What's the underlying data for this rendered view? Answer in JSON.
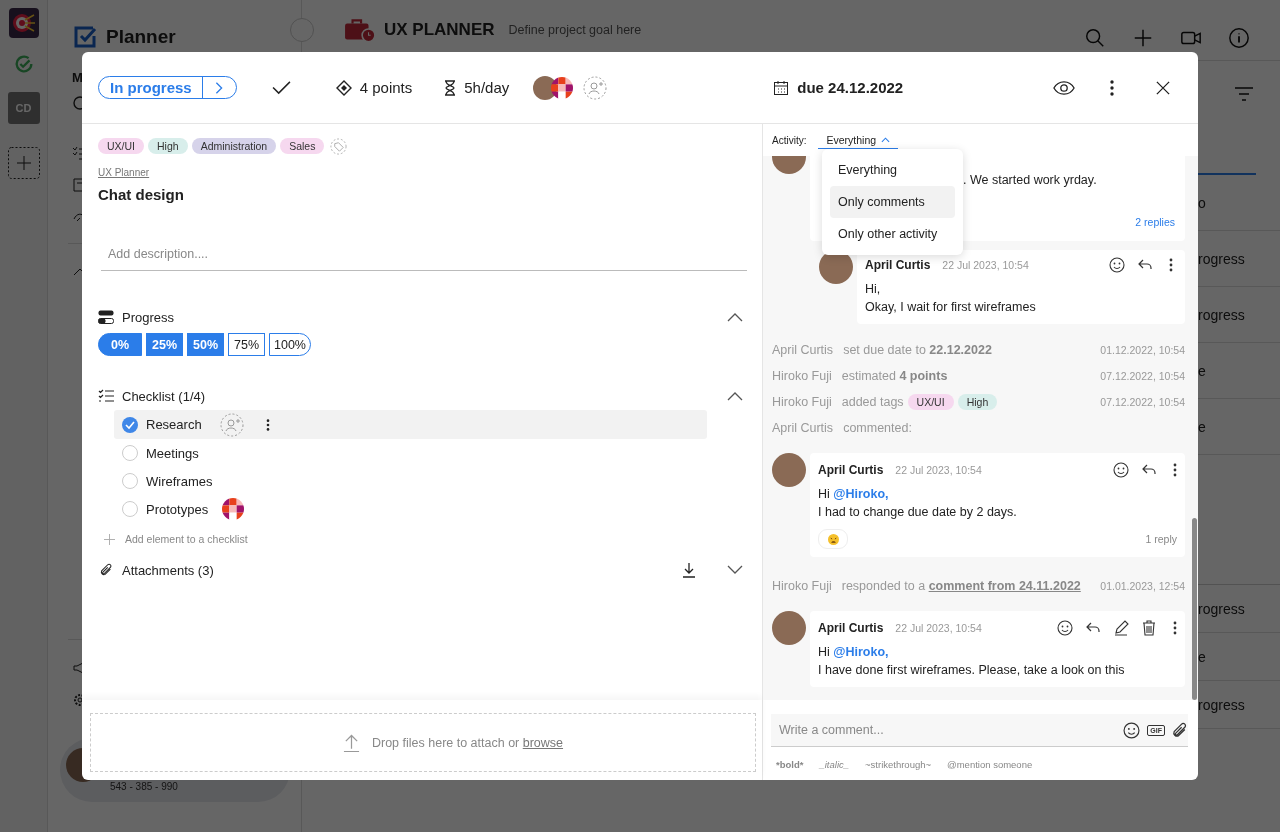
{
  "background": {
    "rail": {
      "badge": "CD"
    },
    "sidebar": {
      "title": "Planner",
      "section_letter": "M",
      "phone": "543 - 385 - 990"
    },
    "header": {
      "title": "UX PLANNER",
      "goal_placeholder": "Define project goal here"
    },
    "list_fragments_upper": [
      "o",
      "rogress",
      "rogress",
      "e",
      "e"
    ],
    "list_fragments_lower": [
      "rogress",
      "e",
      "rogress"
    ]
  },
  "task": {
    "status": "In progress",
    "points": "4 points",
    "time": "5h/day",
    "due": "due 24.12.2022",
    "tags": [
      {
        "label": "UX/UI",
        "color": "#f6d8ef"
      },
      {
        "label": "High",
        "color": "#d8eeeb"
      },
      {
        "label": "Administration",
        "color": "#d6d3ea"
      },
      {
        "label": "Sales",
        "color": "#f6d8ef"
      }
    ],
    "project": "UX Planner",
    "title": "Chat design",
    "description_placeholder": "Add description....",
    "progress": {
      "label": "Progress",
      "steps": [
        {
          "label": "0%",
          "filled": true
        },
        {
          "label": "25%",
          "filled": true
        },
        {
          "label": "50%",
          "filled": true
        },
        {
          "label": "75%",
          "filled": false
        },
        {
          "label": "100%",
          "filled": false
        }
      ]
    },
    "checklist": {
      "title": "Checklist (1/4)",
      "add_label": "Add element to a checklist",
      "items": [
        {
          "label": "Research",
          "checked": true,
          "highlighted": true,
          "assigned": false
        },
        {
          "label": "Meetings",
          "checked": false,
          "highlighted": false,
          "assigned": false
        },
        {
          "label": "Wireframes",
          "checked": false,
          "highlighted": false,
          "assigned": false
        },
        {
          "label": "Prototypes",
          "checked": false,
          "highlighted": false,
          "assigned": true
        }
      ]
    },
    "attachments": {
      "title": "Attachments (3)"
    },
    "drop": {
      "text": "Drop files here to attach or ",
      "link": "browse"
    }
  },
  "activity": {
    "label": "Activity:",
    "filter": "Everything",
    "options": [
      {
        "label": "Everything",
        "hovered": false
      },
      {
        "label": "Only comments",
        "hovered": true
      },
      {
        "label": "Only other activity",
        "hovered": false
      }
    ],
    "feed": [
      {
        "kind": "partial",
        "body": ". We started work yrday.",
        "replies": "2 replies"
      },
      {
        "kind": "reply",
        "author": "April Curtis",
        "time": "22 Jul 2023, 10:54",
        "lines": [
          "Hi,",
          "Okay, I wait for first wireframes"
        ]
      },
      {
        "kind": "event",
        "actor": "April Curtis",
        "text": "set due date to **22.12.2022**",
        "time": "01.12.2022, 10:54"
      },
      {
        "kind": "event",
        "actor": "Hiroko Fuji",
        "text": "estimated **4 points**",
        "time": "07.12.2022, 10:54"
      },
      {
        "kind": "tags",
        "actor": "Hiroko Fuji",
        "text": "added tags",
        "tags": [
          {
            "label": "UX/UI",
            "color": "#f6d8ef"
          },
          {
            "label": "High",
            "color": "#d8eeeb"
          }
        ],
        "time": "07.12.2022, 10:54"
      },
      {
        "kind": "event",
        "actor": "April Curtis",
        "text": "commented:"
      },
      {
        "kind": "comment",
        "author": "April Curtis",
        "time": "22 Jul 2023, 10:54",
        "greeting": "Hi",
        "mention": "@Hiroko,",
        "line": "I had to change due date by 2 days.",
        "reaction": true,
        "replies": "1 reply",
        "own": false
      },
      {
        "kind": "link",
        "actor": "Hiroko Fuji",
        "text": "responded to a",
        "link": "comment from 24.11.2022",
        "time": "01.01.2023, 12:54"
      },
      {
        "kind": "comment",
        "author": "April Curtis",
        "time": "22 Jul 2023, 10:54",
        "greeting": "Hi",
        "mention": "@Hiroko,",
        "line": "I have done first wireframes. Please, take a look on this",
        "reaction": false,
        "own": true
      }
    ],
    "composer": {
      "placeholder": "Write a comment...",
      "gif_label": "GIF",
      "hints": [
        "*bold*",
        "_italic_",
        "~strikethrough~",
        "@mention someone"
      ]
    }
  }
}
